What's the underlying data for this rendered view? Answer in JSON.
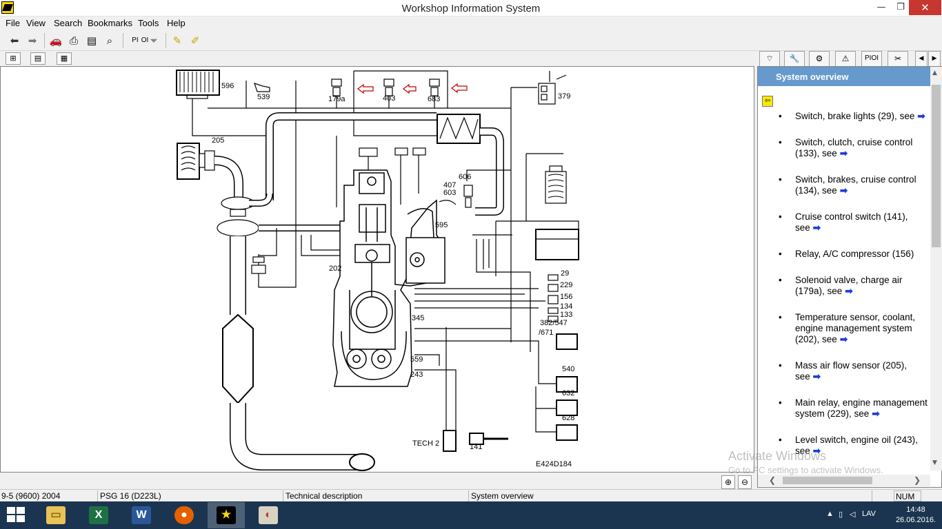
{
  "window": {
    "title": "Workshop Information System"
  },
  "menu": [
    "File",
    "View",
    "Search",
    "Bookmarks",
    "Tools",
    "Help"
  ],
  "toolbar": {
    "pi_label": "PI",
    "oi_label": "OI"
  },
  "tabs": {
    "pi_label": "PI",
    "oi_label": "OI"
  },
  "diagram": {
    "figure_id": "E424D184",
    "labels": {
      "l596": "596",
      "l539": "539",
      "l179a": "179a",
      "l403": "403",
      "l683": "683",
      "l379": "379",
      "l205": "205",
      "l606": "606",
      "l407": "407",
      "l603": "603",
      "l595": "595",
      "l202": "202",
      "l345": "345",
      "l559": "559",
      "l243": "243",
      "l29": "29",
      "l229": "229",
      "l156": "156",
      "l134": "134",
      "l133": "133",
      "l382": "382/547",
      "l671": "/671",
      "l540": "540",
      "l632": "632",
      "l628": "628",
      "tech2": "TECH 2",
      "l141": "141"
    }
  },
  "system_overview": {
    "header": "System overview",
    "items": [
      {
        "text": "Switch, brake lights (29),",
        "see": "see"
      },
      {
        "text": "Switch, clutch, cruise control (133),",
        "see": "see"
      },
      {
        "text": "Switch, brakes, cruise control (134),",
        "see": "see"
      },
      {
        "text": "Cruise control switch (141),",
        "see": "see"
      },
      {
        "text": "Relay, A/C compressor (156)",
        "see": ""
      },
      {
        "text": "Solenoid valve, charge air (179a),",
        "see": "see"
      },
      {
        "text": "Temperature sensor, coolant, engine management system (202),",
        "see": "see"
      },
      {
        "text": "Mass air flow sensor (205),",
        "see": "see"
      },
      {
        "text": "Main relay, engine management system (229),",
        "see": "see"
      },
      {
        "text": "Level switch, engine oil (243),",
        "see": "see"
      }
    ]
  },
  "watermark": {
    "line1": "Activate Windows",
    "line2": "Go to PC settings to activate Windows."
  },
  "status": {
    "model": "9-5 (9600) 2004",
    "engine": "PSG 16 (D223L)",
    "doc": "Technical description",
    "section": "System overview",
    "num": "NUM"
  },
  "taskbar": {
    "time": "14:48",
    "date": "26.06.2016.",
    "lang": "LAV"
  },
  "colors": {
    "header": "#6699cc",
    "arrow": "#1a3ce0",
    "taskbar": "#1b3550"
  }
}
